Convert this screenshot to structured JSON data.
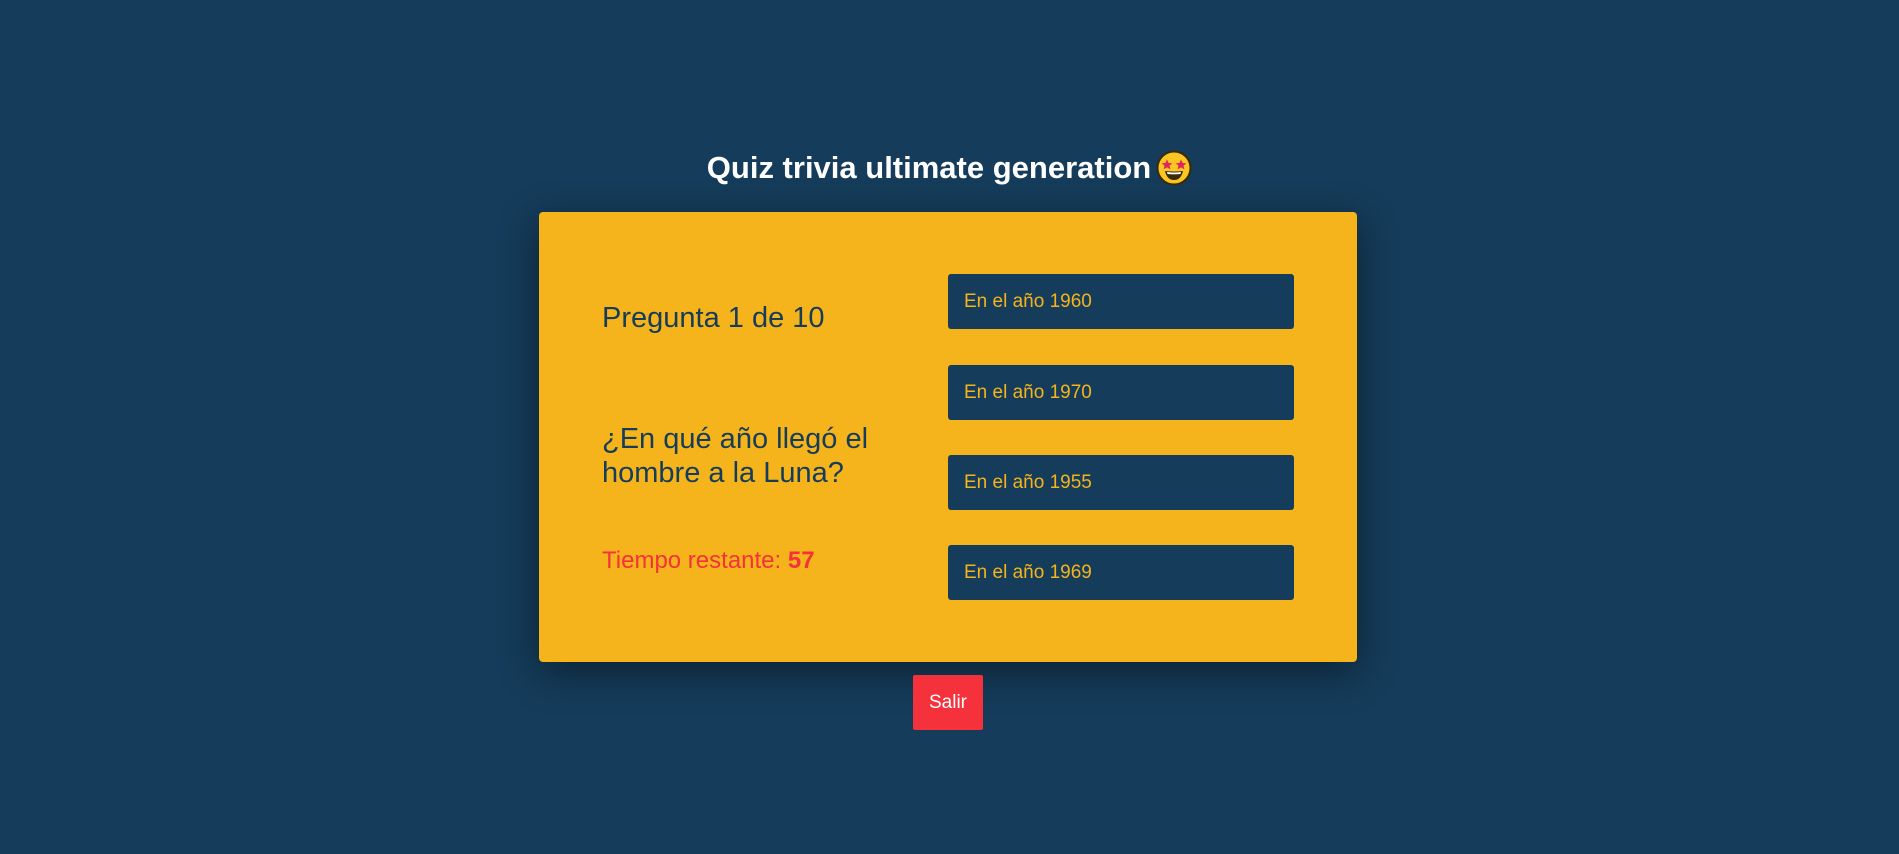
{
  "header": {
    "title": "Quiz trivia ultimate generation",
    "emoji_icon": "star-struck-face-icon"
  },
  "quiz": {
    "counter": "Pregunta 1 de 10",
    "question": "¿En qué año llegó el hombre a la Luna?",
    "timer_label": "Tiempo restante: ",
    "timer_value": "57",
    "answers": [
      "En el año 1960",
      "En el año 1970",
      "En el año 1955",
      "En el año 1969"
    ]
  },
  "exit_label": "Salir",
  "colors": {
    "background": "#153c5a",
    "card": "#f5b41b",
    "accent_red": "#f5323c",
    "text_dark": "#153c5a",
    "text_light": "#ffffff"
  }
}
